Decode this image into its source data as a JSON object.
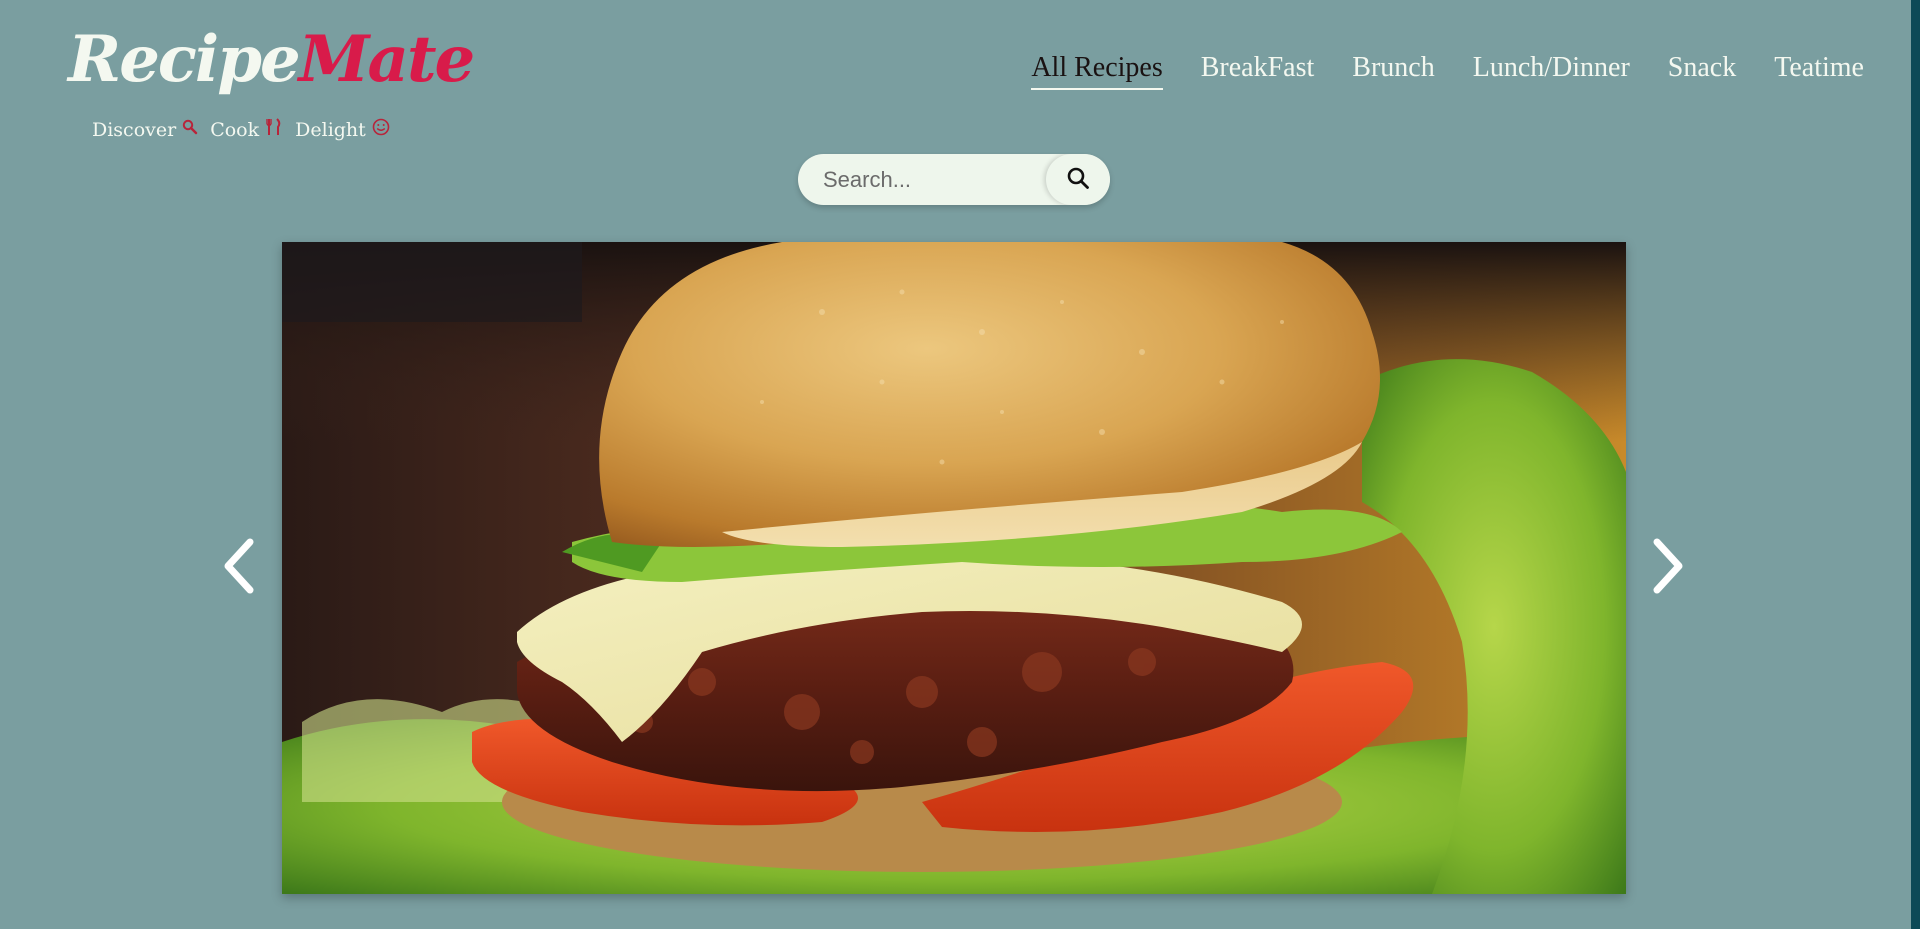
{
  "logo": {
    "part1": "Recipe",
    "part2": "Mate",
    "tagline": {
      "word1": "Discover",
      "icon1": "magnifier-icon",
      "word2": "Cook",
      "icon2": "utensils-icon",
      "word3": "Delight",
      "icon3": "smile-icon"
    }
  },
  "nav": {
    "items": [
      {
        "label": "All Recipes",
        "active": true
      },
      {
        "label": "BreakFast",
        "active": false
      },
      {
        "label": "Brunch",
        "active": false
      },
      {
        "label": "Lunch/Dinner",
        "active": false
      },
      {
        "label": "Snack",
        "active": false
      },
      {
        "label": "Teatime",
        "active": false
      }
    ]
  },
  "search": {
    "placeholder": "Search...",
    "value": "",
    "icon": "search-icon"
  },
  "carousel": {
    "slide_image": "burger-photo",
    "prev_icon": "chevron-left-icon",
    "next_icon": "chevron-right-icon"
  },
  "colors": {
    "background": "#7a9ea0",
    "brand_accent": "#d81b4a",
    "light_text": "#f4f8f0",
    "active_nav_text": "#1a1212",
    "search_bg": "#eef6ec",
    "scroll_edge": "#0d4a57"
  }
}
